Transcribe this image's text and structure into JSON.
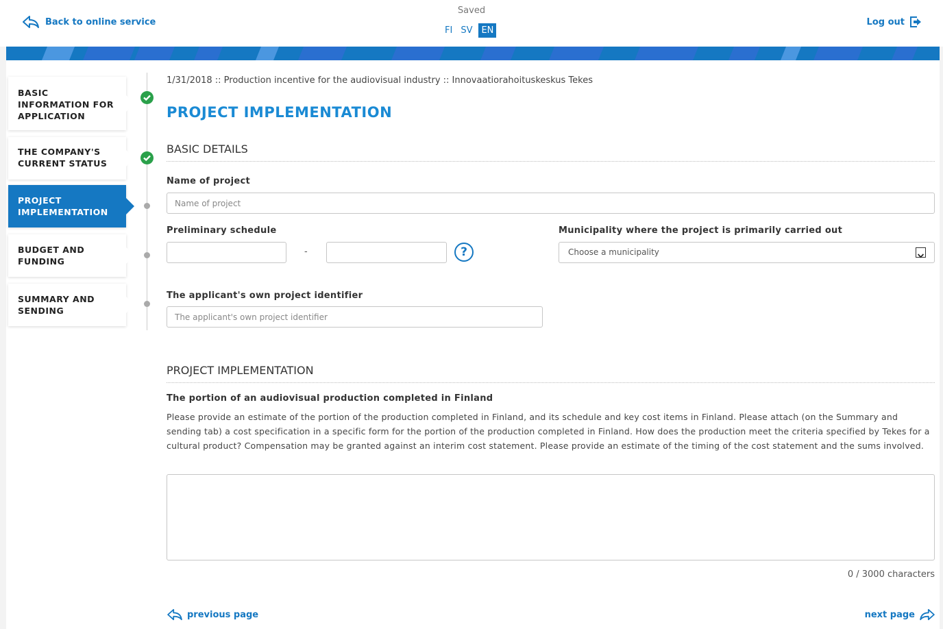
{
  "header": {
    "back_label": "Back to online service",
    "saved_label": "Saved",
    "languages": [
      "FI",
      "SV",
      "EN"
    ],
    "active_language": "EN",
    "logout_label": "Log out"
  },
  "sidebar": {
    "items": [
      {
        "label": "BASIC INFORMATION FOR APPLICATION",
        "state": "done"
      },
      {
        "label": "THE COMPANY'S CURRENT STATUS",
        "state": "done"
      },
      {
        "label": "PROJECT IMPLEMENTATION",
        "state": "active"
      },
      {
        "label": "BUDGET AND FUNDING",
        "state": "todo"
      },
      {
        "label": "SUMMARY AND SENDING",
        "state": "todo"
      }
    ]
  },
  "main": {
    "breadcrumb": "1/31/2018 :: Production incentive for the audiovisual industry :: Innovaatiorahoituskeskus Tekes",
    "page_title": "PROJECT IMPLEMENTATION",
    "basic_details": {
      "section_title": "BASIC DETAILS",
      "name_label": "Name of project",
      "name_placeholder": "Name of project",
      "schedule_label": "Preliminary schedule",
      "schedule_separator": "-",
      "help_symbol": "?",
      "municipality_label": "Municipality where the project is primarily carried out",
      "municipality_value": "Choose a municipality",
      "identifier_label": "The applicant's own project identifier",
      "identifier_placeholder": "The applicant's own project identifier"
    },
    "implementation": {
      "section_title": "PROJECT IMPLEMENTATION",
      "portion_label": "The portion of an audiovisual production completed in Finland",
      "description": "Please provide an estimate of the portion of the production completed in Finland, and its schedule and key cost items in Finland. Please attach (on the Summary and sending tab) a cost specification in a specific form for the portion of the production completed in Finland. How does the production meet the criteria specified by Tekes for a cultural product? Compensation may be granted against an interim cost statement. Please provide an estimate of the timing of the cost statement and the sums involved.",
      "counter": "0 / 3000 characters"
    },
    "pager": {
      "previous_label": "previous page",
      "next_label": "next page"
    }
  },
  "colors": {
    "brand_blue": "#1578c2",
    "title_blue": "#1a8ad4",
    "done_green": "#2aa04a"
  }
}
